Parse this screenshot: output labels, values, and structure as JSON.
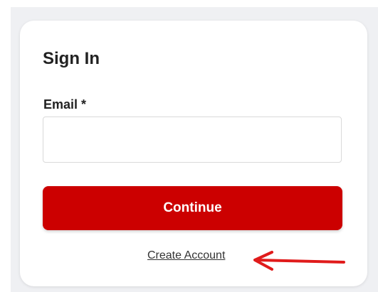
{
  "sign_in": {
    "title": "Sign In",
    "email_label": "Email *",
    "email_value": "",
    "continue_label": "Continue",
    "create_account_label": "Create Account"
  },
  "colors": {
    "accent": "#cc0000",
    "annotation_arrow": "#e01b1b"
  },
  "annotations": {
    "arrow_icon": "left-arrow-icon"
  }
}
